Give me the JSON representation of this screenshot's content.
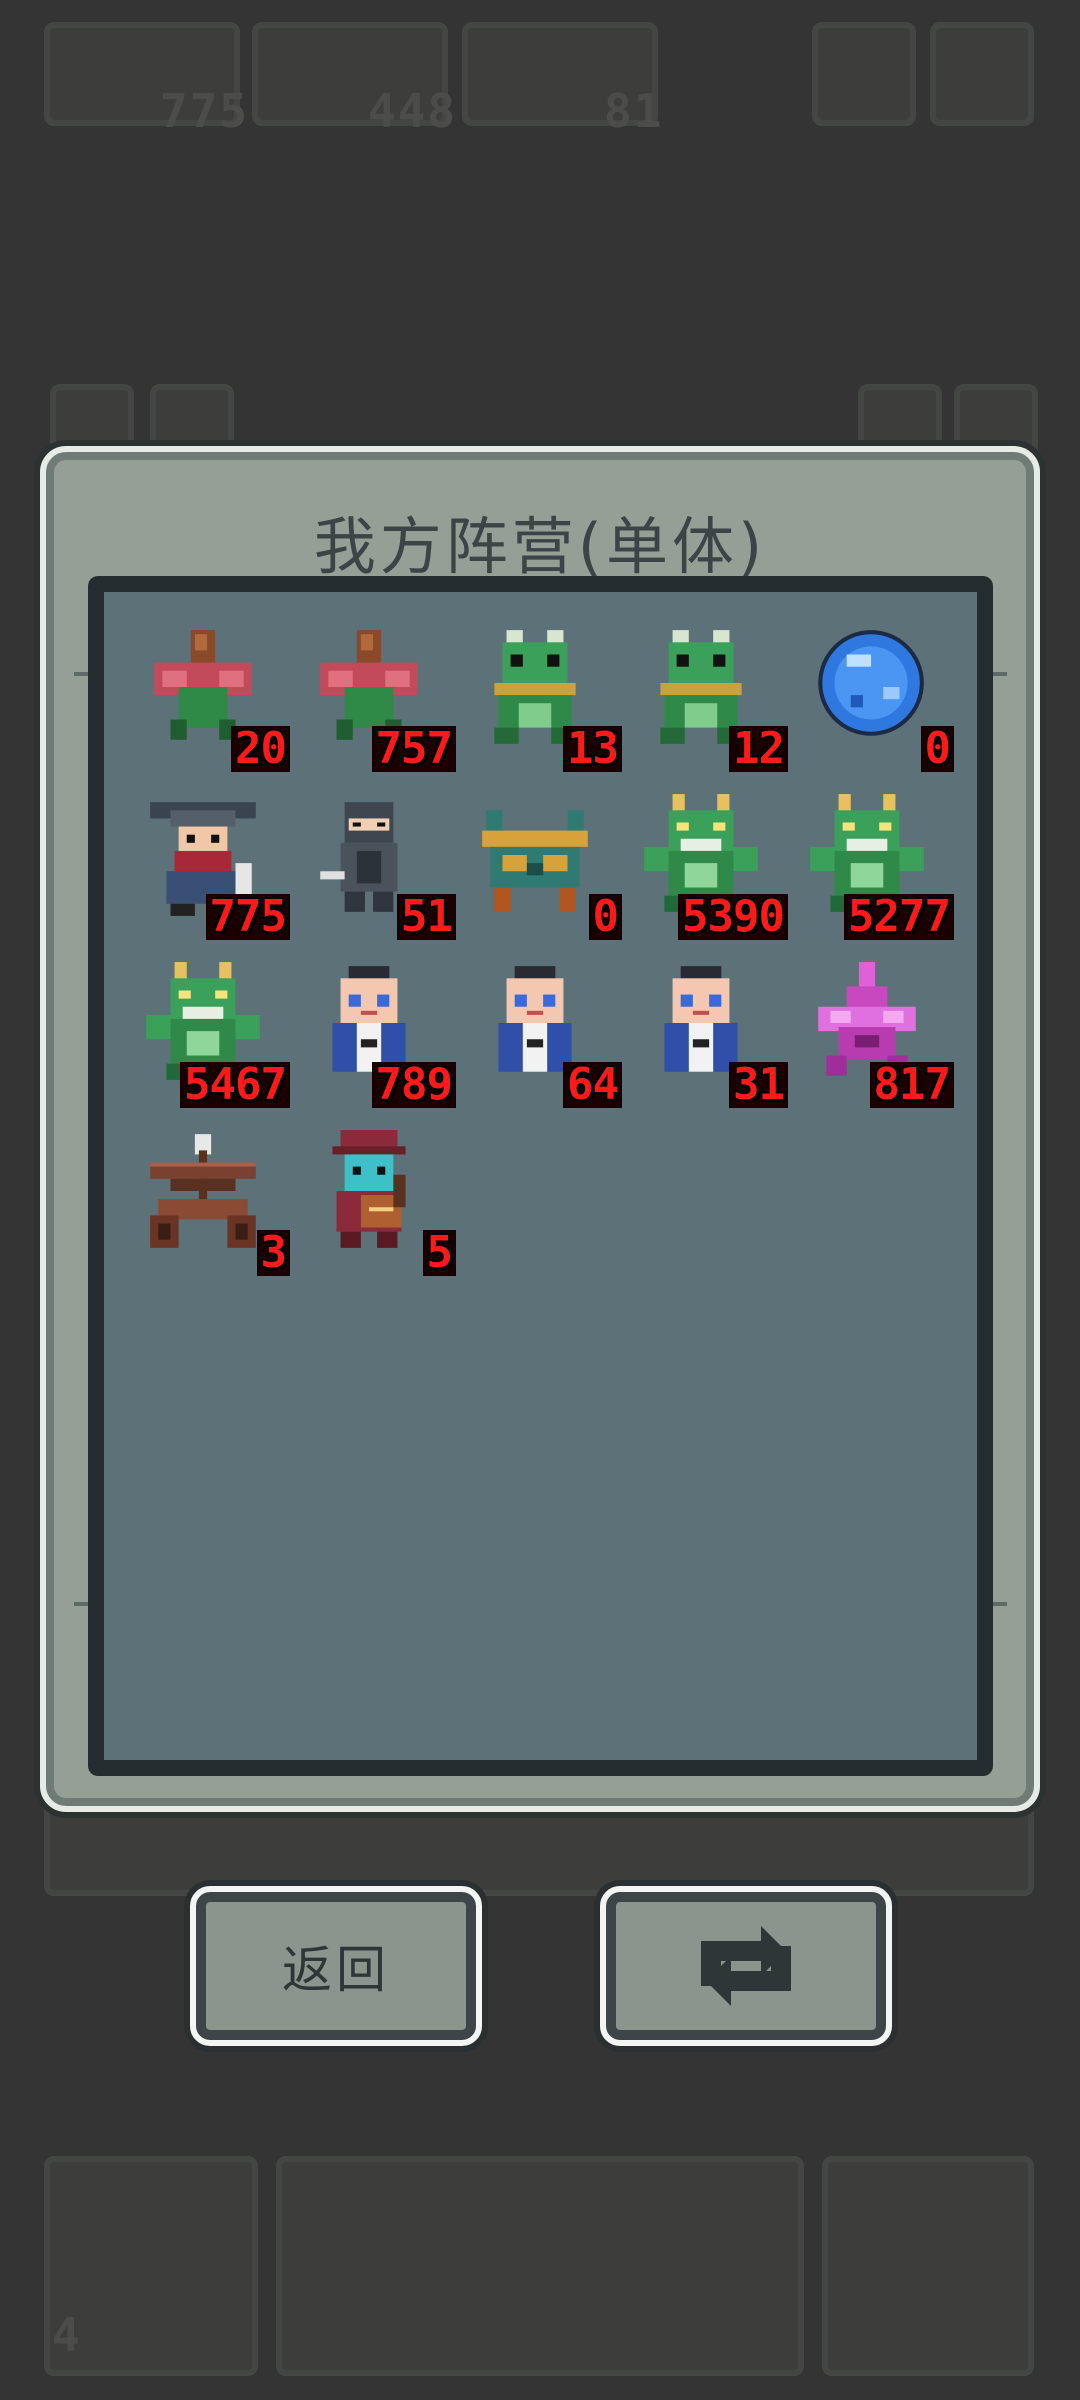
{
  "background": {
    "top_counters": [
      "775",
      "448",
      "81"
    ],
    "bottom_counter": "4"
  },
  "dialog": {
    "title": "我方阵营(单体)"
  },
  "units": [
    {
      "kind": "mandrake",
      "count": "20"
    },
    {
      "kind": "mandrake",
      "count": "757"
    },
    {
      "kind": "frog-soldier",
      "count": "13"
    },
    {
      "kind": "frog-soldier",
      "count": "12"
    },
    {
      "kind": "blue-orb",
      "count": "0"
    },
    {
      "kind": "bearded-general",
      "count": "775"
    },
    {
      "kind": "ninja",
      "count": "51"
    },
    {
      "kind": "bronze-cauldron",
      "count": "0"
    },
    {
      "kind": "green-dragon",
      "count": "5390"
    },
    {
      "kind": "green-dragon",
      "count": "5277"
    },
    {
      "kind": "green-dragon",
      "count": "5467"
    },
    {
      "kind": "scholar",
      "count": "789"
    },
    {
      "kind": "scholar",
      "count": "64"
    },
    {
      "kind": "scholar",
      "count": "31"
    },
    {
      "kind": "pink-flower-beast",
      "count": "817"
    },
    {
      "kind": "crossbow-cart",
      "count": "3"
    },
    {
      "kind": "blue-musician",
      "count": "5"
    }
  ],
  "buttons": {
    "back_label": "返回",
    "swap_icon": "swap-arrows-icon"
  },
  "colors": {
    "count_text": "#ff1a1a",
    "dialog_bg": "#949f96",
    "inner_bg": "#5d7179"
  }
}
